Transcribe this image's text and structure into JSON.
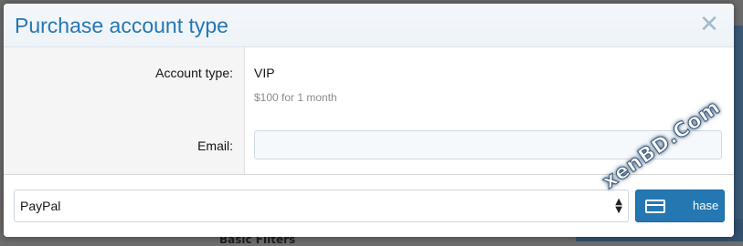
{
  "dialog": {
    "title": "Purchase account type",
    "close_icon": "close-icon"
  },
  "form": {
    "account_type_label": "Account type:",
    "account_type_value": "VIP",
    "account_type_price": "$100 for 1 month",
    "email_label": "Email:",
    "email_value": "",
    "email_placeholder": ""
  },
  "footer": {
    "payment_method_selected": "PayPal",
    "purchase_button_label": "Purchase",
    "purchase_button_visible_text": "hase",
    "purchase_icon": "credit-card-icon"
  },
  "background": {
    "filters_label": "Basic Filters"
  },
  "watermark": {
    "text": "xenBD.Com"
  },
  "colors": {
    "accent": "#2577b1",
    "title": "#2577b1",
    "close": "#a3b9cd"
  }
}
